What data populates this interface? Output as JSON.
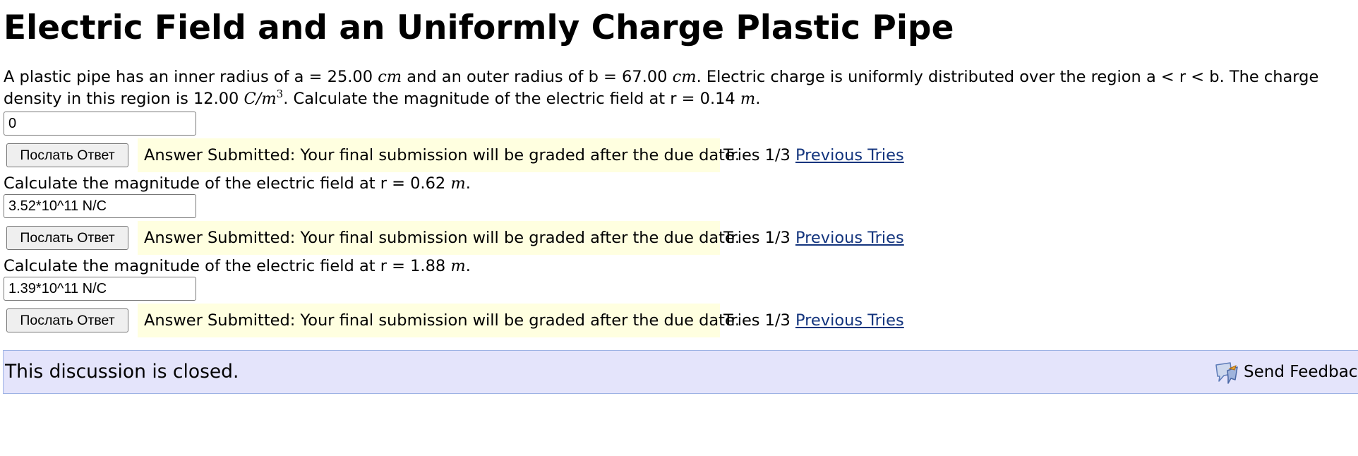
{
  "page": {
    "title": "Electric Field and an Uniformly Charge Plastic Pipe"
  },
  "problem": {
    "intro_1": "A plastic pipe has an inner radius of a = 25.00 ",
    "unit_cm_1": "cm",
    "intro_2": " and an outer radius of b = 67.00 ",
    "unit_cm_2": "cm",
    "intro_3": ". Electric charge is uniformly distributed over the region a < r < b. The charge density in this region is 12.00 ",
    "unit_density_base": "C/m",
    "unit_density_exp": "3",
    "intro_4": ". Calculate the magnitude of the electric field at r = 0.14 ",
    "unit_m": "m",
    "intro_end": "."
  },
  "parts": [
    {
      "answer_value": "0",
      "submit_label": "Послать Ответ",
      "status": "Answer Submitted: Your final submission will be graded after the due date.",
      "tries": "Tries 1/3",
      "previous_tries_label": "Previous Tries"
    },
    {
      "question_prefix": "Calculate the magnitude of the electric field at r = 0.62 ",
      "question_unit": "m",
      "question_end": ".",
      "answer_value": "3.52*10^11 N/C",
      "submit_label": "Послать Ответ",
      "status": "Answer Submitted: Your final submission will be graded after the due date.",
      "tries": "Tries 1/3",
      "previous_tries_label": "Previous Tries"
    },
    {
      "question_prefix": "Calculate the magnitude of the electric field at r = 1.88 ",
      "question_unit": "m",
      "question_end": ".",
      "answer_value": "1.39*10^11 N/C",
      "submit_label": "Послать Ответ",
      "status": "Answer Submitted: Your final submission will be graded after the due date.",
      "tries": "Tries 1/3",
      "previous_tries_label": "Previous Tries"
    }
  ],
  "discussion": {
    "closed_text": "This discussion is closed.",
    "feedback_label": "Send Feedback",
    "feedback_icon": "feedback-icon"
  },
  "colors": {
    "notice_background": "#ffffe0",
    "discussion_background": "#e4e4fb",
    "link": "#14357e"
  }
}
